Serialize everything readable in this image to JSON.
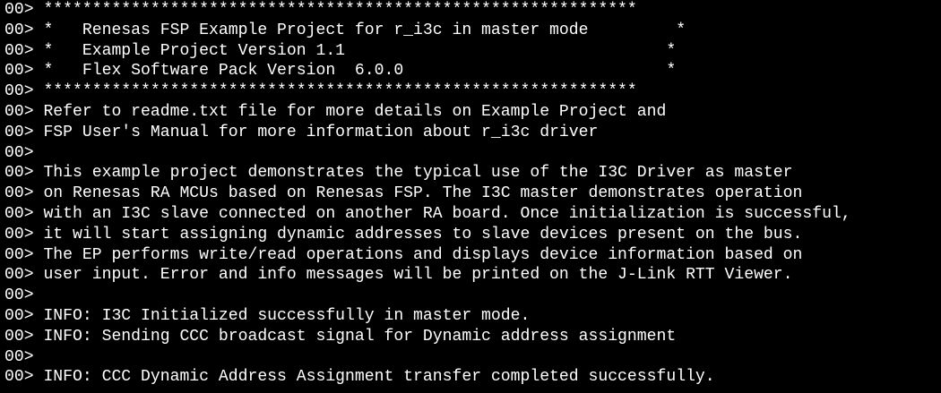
{
  "window": {
    "prefix": "00> ",
    "colors": {
      "background": "#000000",
      "foreground": "#ffffff"
    }
  },
  "lines": [
    {
      "text": "*************************************************************"
    },
    {
      "text": "*   Renesas FSP Example Project for r_i3c in master mode         *"
    },
    {
      "text": "*   Example Project Version 1.1                                 *"
    },
    {
      "text": "*   Flex Software Pack Version  6.0.0                           *"
    },
    {
      "text": "*************************************************************"
    },
    {
      "text": "Refer to readme.txt file for more details on Example Project and"
    },
    {
      "text": "FSP User's Manual for more information about r_i3c driver"
    },
    {
      "text": ""
    },
    {
      "text": "This example project demonstrates the typical use of the I3C Driver as master"
    },
    {
      "text": "on Renesas RA MCUs based on Renesas FSP. The I3C master demonstrates operation"
    },
    {
      "text": "with an I3C slave connected on another RA board. Once initialization is successful,"
    },
    {
      "text": "it will start assigning dynamic addresses to slave devices present on the bus."
    },
    {
      "text": "The EP performs write/read operations and displays device information based on"
    },
    {
      "text": "user input. Error and info messages will be printed on the J-Link RTT Viewer."
    },
    {
      "text": ""
    },
    {
      "text": "INFO: I3C Initialized successfully in master mode."
    },
    {
      "text": "INFO: Sending CCC broadcast signal for Dynamic address assignment"
    },
    {
      "text": ""
    },
    {
      "text": "INFO: CCC Dynamic Address Assignment transfer completed successfully."
    }
  ]
}
